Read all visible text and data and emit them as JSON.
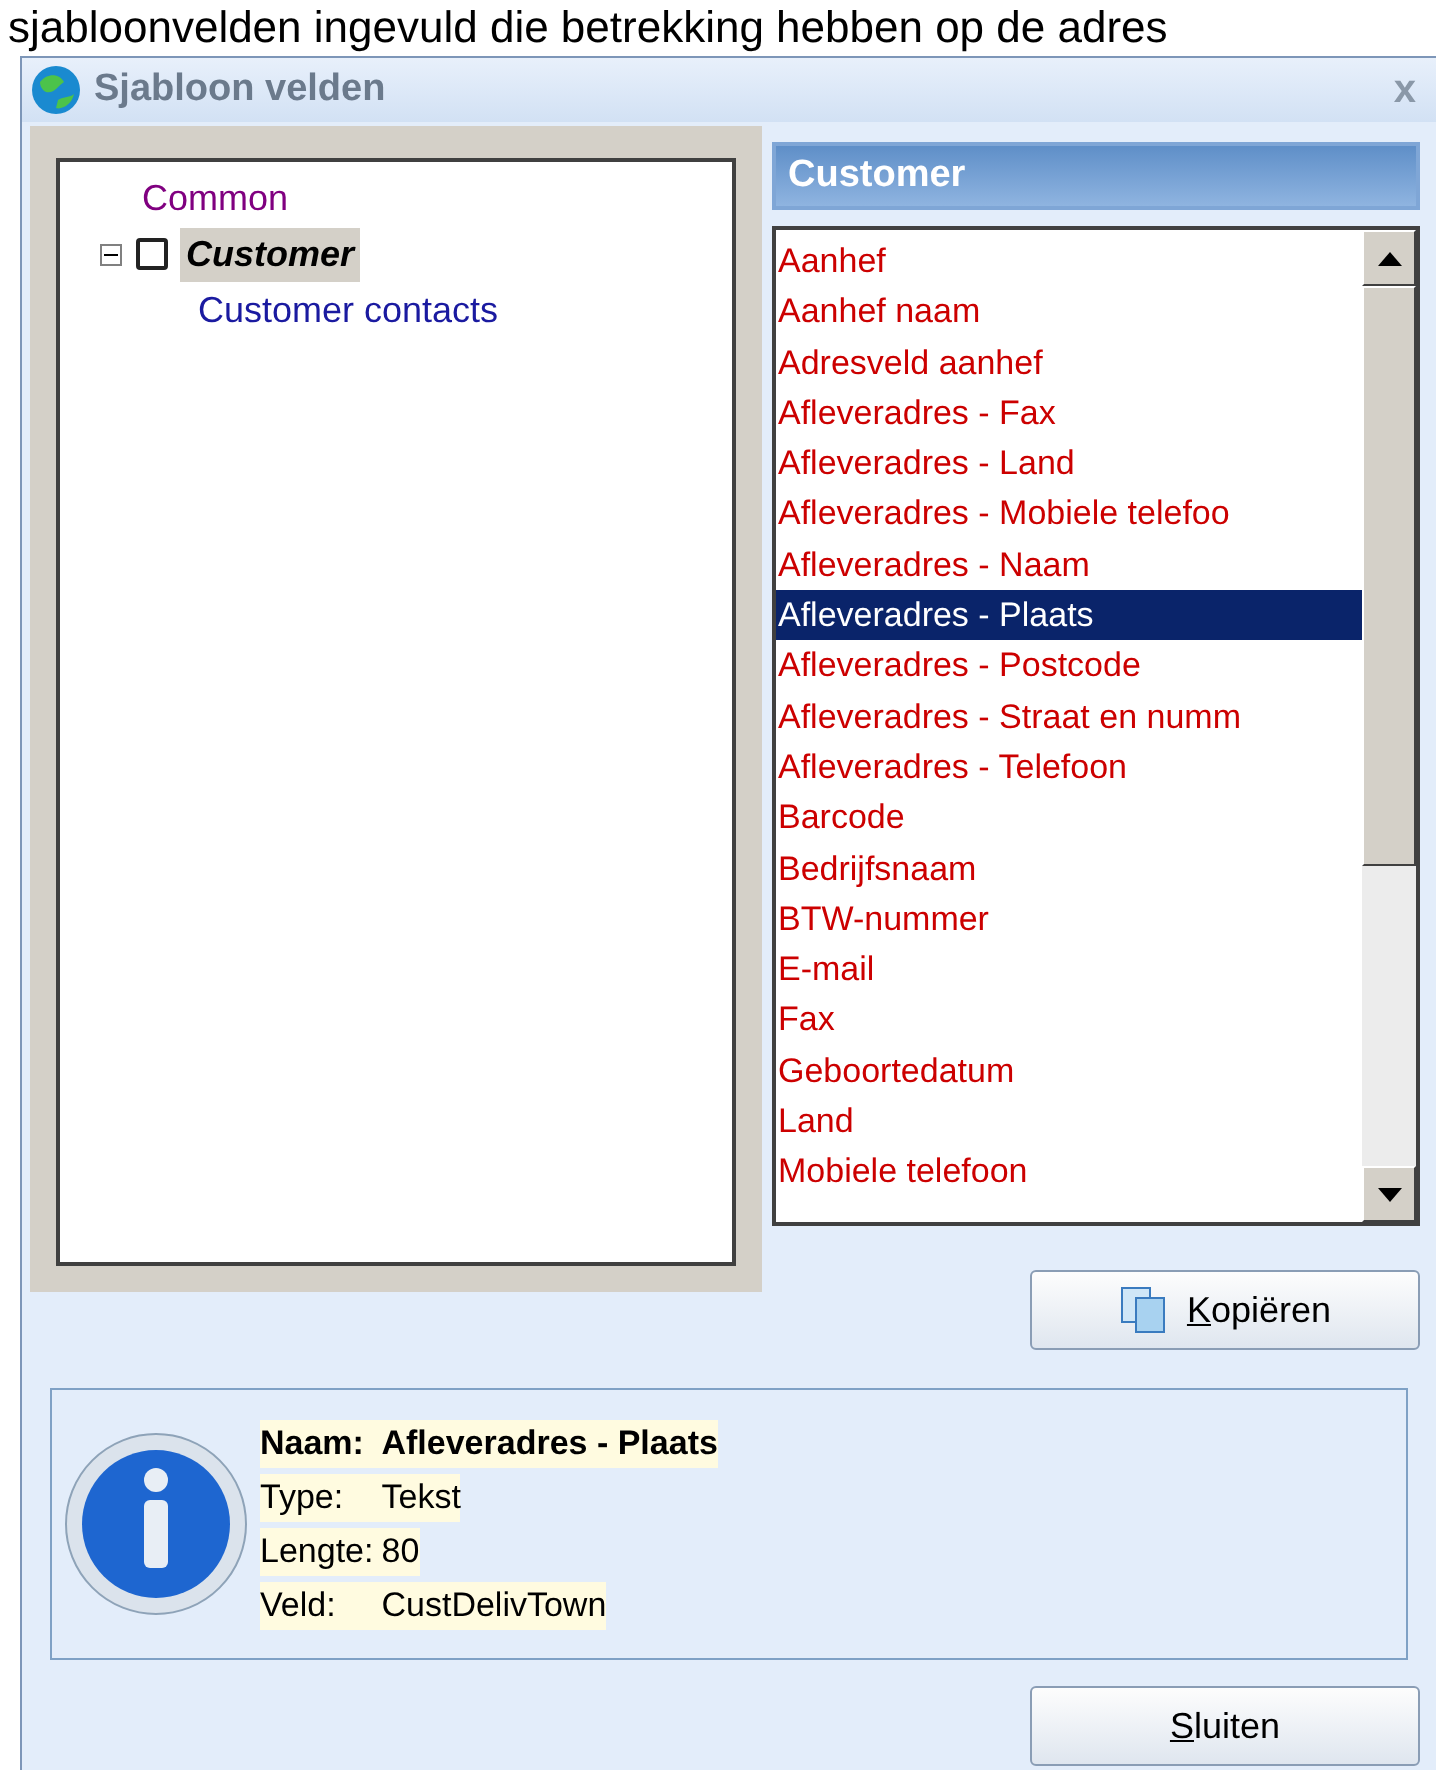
{
  "caption": "sjabloonvelden ingevuld die betrekking hebben op de adres",
  "window": {
    "title": "Sjabloon velden",
    "close": "x"
  },
  "tree": [
    {
      "label": "Common",
      "kind": "plain",
      "selected": false
    },
    {
      "label": "Customer",
      "kind": "checkbox",
      "checked": false,
      "expanded": true,
      "selected": true,
      "children": [
        {
          "label": "Customer contacts",
          "kind": "plain",
          "selected": false
        }
      ]
    }
  ],
  "list_header": "Customer",
  "fields": [
    {
      "label": "Aanhef",
      "selected": false
    },
    {
      "label": "Aanhef naam",
      "selected": false
    },
    {
      "label": "Adresveld aanhef",
      "selected": false
    },
    {
      "label": "Afleveradres - Fax",
      "selected": false
    },
    {
      "label": "Afleveradres - Land",
      "selected": false
    },
    {
      "label": "Afleveradres - Mobiele telefoo",
      "selected": false
    },
    {
      "label": "Afleveradres - Naam",
      "selected": false
    },
    {
      "label": "Afleveradres - Plaats",
      "selected": true
    },
    {
      "label": "Afleveradres - Postcode",
      "selected": false
    },
    {
      "label": "Afleveradres - Straat en numm",
      "selected": false
    },
    {
      "label": "Afleveradres - Telefoon",
      "selected": false
    },
    {
      "label": "Barcode",
      "selected": false
    },
    {
      "label": "Bedrijfsnaam",
      "selected": false
    },
    {
      "label": "BTW-nummer",
      "selected": false
    },
    {
      "label": "E-mail",
      "selected": false
    },
    {
      "label": "Fax",
      "selected": false
    },
    {
      "label": "Geboortedatum",
      "selected": false
    },
    {
      "label": "Land",
      "selected": false
    },
    {
      "label": "Mobiele telefoon",
      "selected": false
    }
  ],
  "copy_button": {
    "accelerator": "K",
    "rest": "opiëren"
  },
  "info": [
    {
      "label": "Naam:",
      "value": "Afleveradres - Plaats",
      "kind": "bold"
    },
    {
      "label": "Type:",
      "value": "Tekst",
      "kind": "plain"
    },
    {
      "label": "Lengte:",
      "value": "80",
      "kind": "plain"
    },
    {
      "label": "Veld:",
      "value": "CustDelivTown",
      "kind": "plain"
    }
  ],
  "close_button": {
    "accelerator": "S",
    "rest": "luiten"
  }
}
